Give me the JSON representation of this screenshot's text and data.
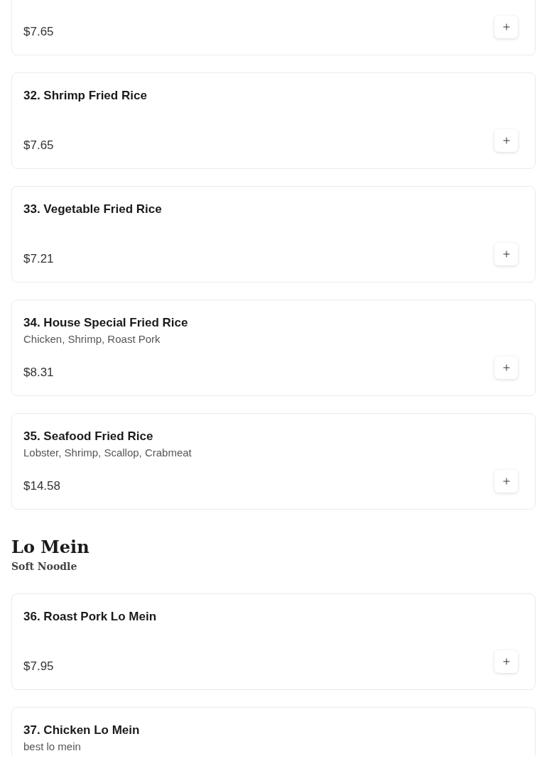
{
  "sections": [
    {
      "items": [
        {
          "price": "$7.65"
        },
        {
          "title": "32. Shrimp Fried Rice",
          "price": "$7.65"
        },
        {
          "title": "33. Vegetable Fried Rice",
          "price": "$7.21"
        },
        {
          "title": "34. House Special Fried Rice",
          "description": "Chicken, Shrimp, Roast Pork",
          "price": "$8.31"
        },
        {
          "title": "35. Seafood Fried Rice",
          "description": "Lobster, Shrimp, Scallop, Crabmeat",
          "price": "$14.58"
        }
      ]
    },
    {
      "title": "Lo Mein",
      "subtitle": "Soft Noodle",
      "items": [
        {
          "title": "36. Roast Pork Lo Mein",
          "price": "$7.95"
        },
        {
          "title": "37. Chicken Lo Mein",
          "description": "best lo mein"
        }
      ]
    }
  ]
}
